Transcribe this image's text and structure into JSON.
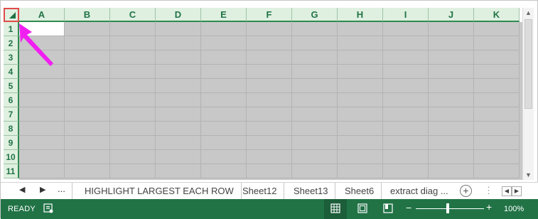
{
  "columns": [
    "A",
    "B",
    "C",
    "D",
    "E",
    "F",
    "G",
    "H",
    "I",
    "J",
    "K"
  ],
  "rows": [
    "1",
    "2",
    "3",
    "4",
    "5",
    "6",
    "7",
    "8",
    "9",
    "10",
    "11"
  ],
  "active_cell": "A1",
  "tabs": {
    "ellipsis": "...",
    "items": [
      "HIGHLIGHT LARGEST EACH ROW",
      "Sheet12",
      "Sheet13",
      "Sheet6",
      "extract diag ..."
    ],
    "add_sheet_label": "⊕"
  },
  "status": {
    "ready": "READY",
    "zoom": "100%"
  },
  "colors": {
    "header_bg": "#dff0e0",
    "header_text": "#217346",
    "selection_fill": "#c8c8c8",
    "status_bar": "#217346",
    "annotation_arrow": "#f020f0",
    "corner_highlight_border": "#e04b4b"
  },
  "icons": {
    "select_all": "select-all-triangle-icon",
    "scroll_up": "triangle-up-icon",
    "scroll_down": "triangle-down-icon",
    "tab_prev": "caret-left-icon",
    "tab_next": "caret-right-icon",
    "macro": "macro-record-icon",
    "normal_view": "grid-view-icon",
    "page_layout": "page-layout-icon",
    "page_break": "page-break-icon",
    "zoom_out": "minus-icon",
    "zoom_in": "plus-icon"
  }
}
